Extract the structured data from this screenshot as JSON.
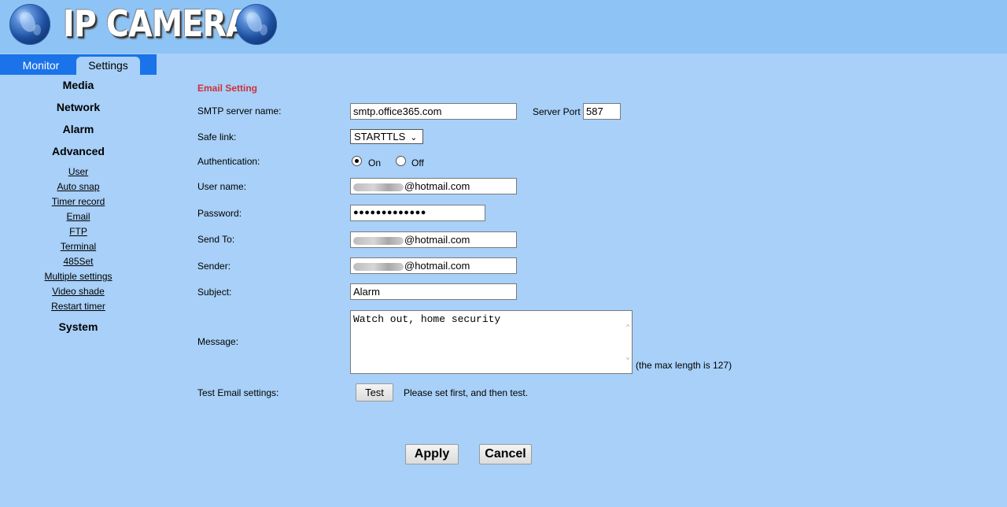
{
  "header": {
    "title": "IP CAMERA"
  },
  "tabs": {
    "monitor": "Monitor",
    "settings": "Settings"
  },
  "nav": {
    "media": "Media",
    "network": "Network",
    "alarm": "Alarm",
    "advanced": "Advanced",
    "advanced_items": [
      "User",
      "Auto snap",
      "Timer record",
      "Email",
      "FTP",
      "Terminal",
      "485Set",
      "Multiple settings",
      "Video shade",
      "Restart timer"
    ],
    "system": "System"
  },
  "email": {
    "section_title": "Email Setting",
    "smtp_label": "SMTP server name:",
    "smtp_value": "smtp.office365.com",
    "port_label": "Server Port",
    "port_value": "587",
    "safe_link_label": "Safe link:",
    "safe_link_value": "STARTTLS",
    "auth_label": "Authentication:",
    "auth_on": "On",
    "auth_off": "Off",
    "username_label": "User name:",
    "username_suffix": "@hotmail.com",
    "password_label": "Password:",
    "password_value": "●●●●●●●●●●●●●",
    "sendto_label": "Send To:",
    "sendto_suffix": "@hotmail.com",
    "sender_label": "Sender:",
    "sender_suffix": "@hotmail.com",
    "subject_label": "Subject:",
    "subject_value": "Alarm",
    "message_label": "Message:",
    "message_value": "Watch out, home security",
    "max_length_note": "(the max length is 127)",
    "test_label": "Test Email settings:",
    "test_button": "Test",
    "test_hint": "Please set first, and then test.",
    "apply_button": "Apply",
    "cancel_button": "Cancel"
  }
}
